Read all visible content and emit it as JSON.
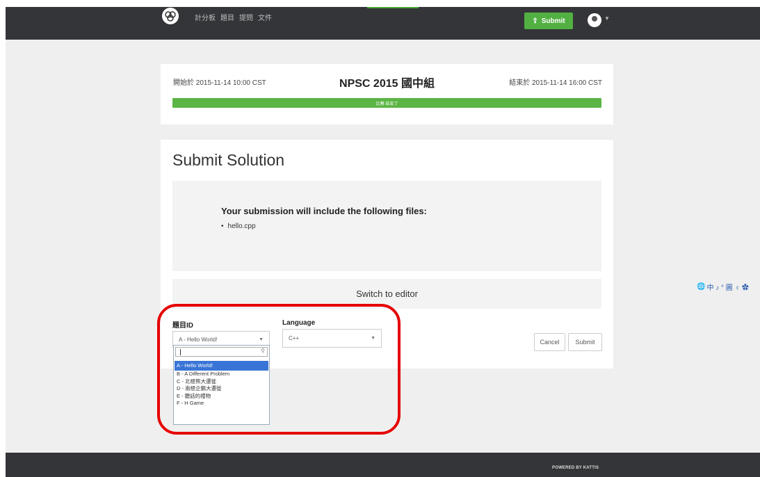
{
  "nav": {
    "links": [
      "計分板",
      "題目",
      "提問",
      "文件"
    ],
    "submit_label": "Submit"
  },
  "contest": {
    "start": "開始於 2015-11-14 10:00 CST",
    "title": "NPSC 2015 國中組",
    "end": "結束於 2015-11-14 16:00 CST",
    "status": "比賽 結束了",
    "progress": 1.0
  },
  "submit": {
    "title": "Submit Solution",
    "files_heading": "Your submission will include the following files:",
    "files": [
      "hello.cpp"
    ],
    "switch_editor": "Switch to editor",
    "problem_label": "題目ID",
    "language_label": "Language",
    "problem_selected": "A - Hello World!",
    "language_selected": "C++",
    "cancel": "Cancel",
    "submit": "Submit"
  },
  "dropdown": {
    "options": [
      "A - Hello World!",
      "B - A Different Problem",
      "C - 北極熊大遷徙",
      "D - 南極企鵝大遷徙",
      "E - 聽話的禮物",
      "F - H Game"
    ]
  },
  "ime": {
    "chars": "中 ♪ ° 圖 ♀ ✿"
  },
  "footer": {
    "text": "POWERED BY KATTIS"
  },
  "colors": {
    "accent_green": "#52b043",
    "highlight_red": "#e60000",
    "selected_blue": "#3875d7"
  }
}
